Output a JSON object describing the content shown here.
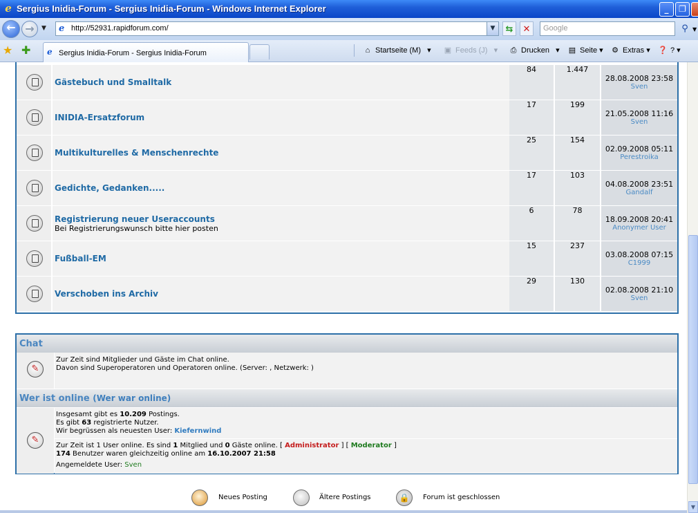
{
  "window": {
    "title": "Sergius Inidia-Forum - Sergius Inidia-Forum - Windows Internet Explorer",
    "min": "_",
    "max": "❐",
    "close": "✕"
  },
  "address": {
    "url": "http://52931.rapidforum.com/",
    "search_placeholder": "Google"
  },
  "tab": {
    "label": "Sergius Inidia-Forum - Sergius Inidia-Forum"
  },
  "commands": {
    "home": "Startseite (M)",
    "feeds": "Feeds (J)",
    "print": "Drucken",
    "page": "Seite",
    "tools": "Extras",
    "help": "?"
  },
  "forums": [
    {
      "name": "Gästebuch und Smalltalk",
      "desc": "",
      "topics": "84",
      "posts": "1.447",
      "last_date": "28.08.2008 23:58",
      "last_user": "Sven"
    },
    {
      "name": "INIDIA-Ersatzforum",
      "desc": "",
      "topics": "17",
      "posts": "199",
      "last_date": "21.05.2008 11:16",
      "last_user": "Sven"
    },
    {
      "name": "Multikulturelles & Menschenrechte",
      "desc": "",
      "topics": "25",
      "posts": "154",
      "last_date": "02.09.2008 05:11",
      "last_user": "Perestroika"
    },
    {
      "name": "Gedichte, Gedanken.....",
      "desc": "",
      "topics": "17",
      "posts": "103",
      "last_date": "04.08.2008 23:51",
      "last_user": "Gandalf"
    },
    {
      "name": "Registrierung neuer Useraccounts",
      "desc": "Bei Registrierungswunsch bitte hier posten",
      "topics": "6",
      "posts": "78",
      "last_date": "18.09.2008 20:41",
      "last_user": "Anonymer User"
    },
    {
      "name": "Fußball-EM",
      "desc": "",
      "topics": "15",
      "posts": "237",
      "last_date": "03.08.2008 07:15",
      "last_user": "C1999"
    },
    {
      "name": "Verschoben ins Archiv",
      "desc": "",
      "topics": "29",
      "posts": "130",
      "last_date": "02.08.2008 21:10",
      "last_user": "Sven"
    }
  ],
  "chat": {
    "title": "Chat",
    "line1": "Zur Zeit sind Mitglieder und Gäste im Chat online.",
    "line2": "Davon sind Superoperatoren und Operatoren online. (Server: , Netzwerk: )"
  },
  "online": {
    "title": "Wer ist online",
    "subtitle": "(Wer war online)",
    "postings_pre": "Insgesamt gibt es ",
    "postings_count": "10.209",
    "postings_post": " Postings.",
    "users_pre": "Es gibt ",
    "users_count": "63",
    "users_post": " registrierte Nutzer.",
    "newest_pre": "Wir begrüssen als neuesten User: ",
    "newest_user": "Kiefernwind",
    "now_pre": "Zur Zeit ist 1 User online. Es sind ",
    "now_members": "1",
    "now_mid": " Mitglied und ",
    "now_guests": "0",
    "now_post": " Gäste online.  [ ",
    "admin": "Administrator",
    "mid_bracket": " ] [ ",
    "moderator": "Moderator",
    "end_bracket": " ]",
    "record_count": "174",
    "record_mid": " Benutzer waren gleichzeitig online am ",
    "record_date": "16.10.2007 21:58",
    "logged_pre": "Angemeldete User: ",
    "logged_user": "Sven"
  },
  "legend": {
    "new": "Neues Posting",
    "old": "Ältere Postings",
    "locked": "Forum ist geschlossen"
  }
}
